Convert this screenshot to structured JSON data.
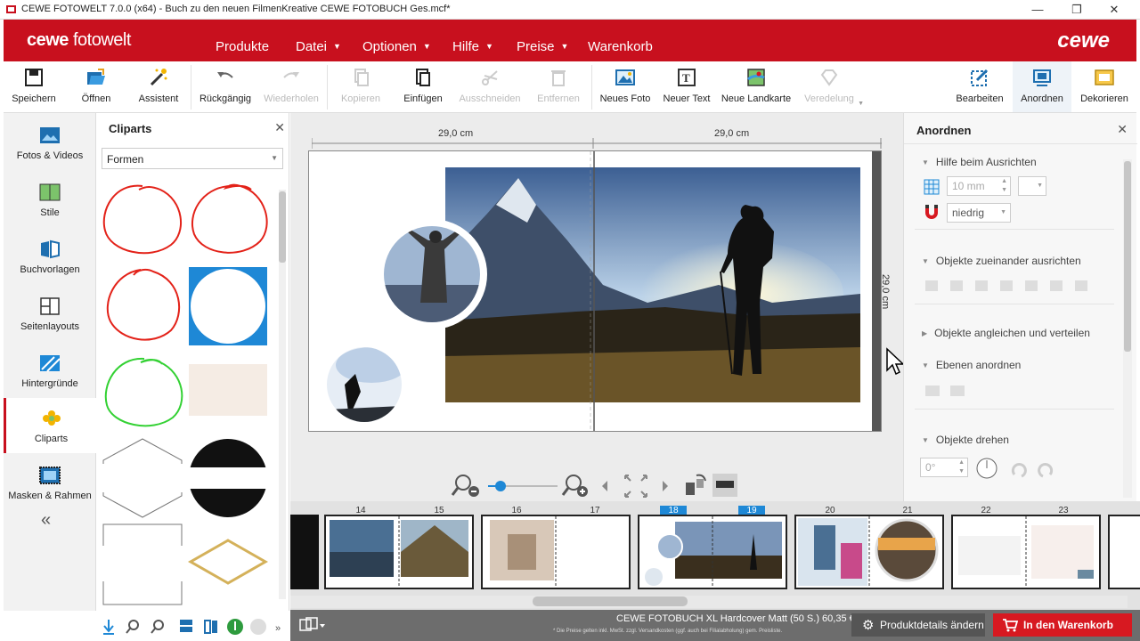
{
  "window": {
    "title": "CEWE FOTOWELT 7.0.0 (x64) - Buch zu den neuen FilmenKreative CEWE FOTOBUCH Ges.mcf*"
  },
  "header": {
    "logo_bold": "cewe",
    "logo_light": " fotowelt",
    "brand": "cewe",
    "menu": [
      "Produkte",
      "Datei",
      "Optionen",
      "Hilfe",
      "Preise",
      "Warenkorb"
    ]
  },
  "toolbar": {
    "save": "Speichern",
    "open": "Öffnen",
    "assistant": "Assistent",
    "undo": "Rückgängig",
    "redo": "Wiederholen",
    "copy": "Kopieren",
    "paste": "Einfügen",
    "cut": "Ausschneiden",
    "remove": "Entfernen",
    "new_photo": "Neues Foto",
    "new_text": "Neuer Text",
    "new_map": "Neue Landkarte",
    "refine": "Veredelung",
    "edit": "Bearbeiten",
    "arrange": "Anordnen",
    "decorate": "Dekorieren"
  },
  "left_nav": [
    "Fotos & Videos",
    "Stile",
    "Buchvorlagen",
    "Seitenlayouts",
    "Hintergründe",
    "Cliparts",
    "Masken & Rahmen"
  ],
  "left_nav_collapse": "«",
  "cliparts_panel": {
    "title": "Cliparts",
    "close": "✕",
    "category": "Formen"
  },
  "canvas": {
    "width_left": "29,0 cm",
    "width_right": "29,0 cm",
    "height": "29,0 cm"
  },
  "arrange_panel": {
    "title": "Anordnen",
    "close": "✕",
    "section_align_help": "Hilfe beim Ausrichten",
    "grid_value": "10 mm",
    "snap_value": "niedrig",
    "section_align_objects": "Objekte zueinander ausrichten",
    "section_distribute": "Objekte angleichen und verteilen",
    "section_layers": "Ebenen anordnen",
    "section_rotate": "Objekte drehen",
    "rotate_value": "0°"
  },
  "filmstrip": {
    "pages": [
      "14",
      "15",
      "16",
      "17",
      "18",
      "19",
      "20",
      "21",
      "22",
      "23"
    ],
    "selected": [
      "18",
      "19"
    ]
  },
  "status": {
    "product": "CEWE FOTOBUCH XL Hardcover Matt (50 S.) 60,35 €*",
    "fine_print": "* Die Preise gelten inkl. MwSt. zzgl. Versandkosten (ggf. auch bei Filialabholung) gem. Preisliste.",
    "details_button": "Produktdetails ändern",
    "cart_button": "In den Warenkorb"
  },
  "colors": {
    "brand_red": "#c8101e",
    "selection_blue": "#1e88d6"
  }
}
